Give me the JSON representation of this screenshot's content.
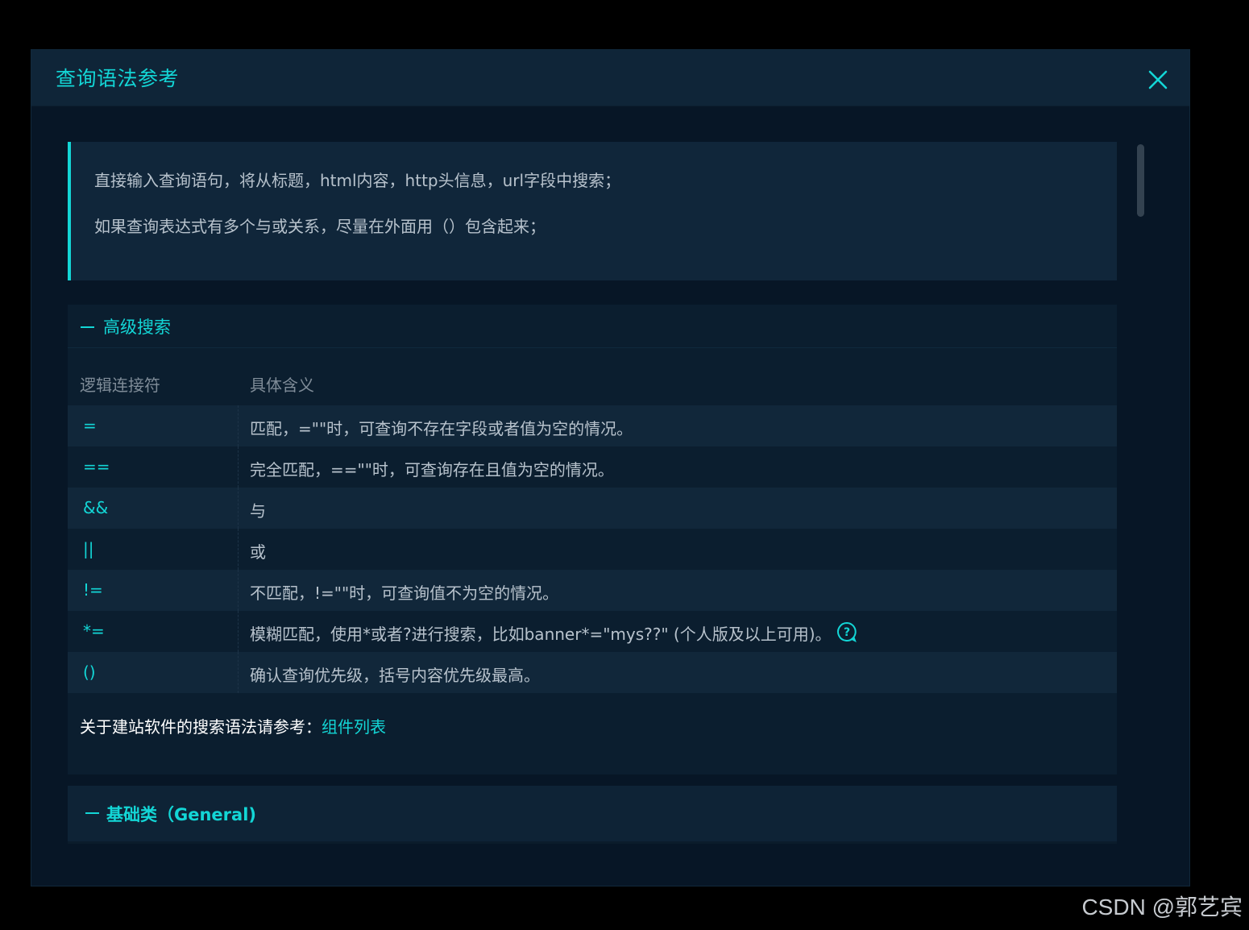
{
  "modal": {
    "title": "查询语法参考"
  },
  "tips": [
    "直接输入查询语句，将从标题，html内容，http头信息，url字段中搜索；",
    "如果查询表达式有多个与或关系，尽量在外面用（）包含起来；"
  ],
  "advanced": {
    "title": "高级搜索",
    "columns": [
      "逻辑连接符",
      "具体含义"
    ],
    "rows": [
      {
        "op": "=",
        "desc": "匹配，=\"\"时，可查询不存在字段或者值为空的情况。"
      },
      {
        "op": "==",
        "desc": "完全匹配，==\"\"时，可查询存在且值为空的情况。"
      },
      {
        "op": "&&",
        "desc": "与"
      },
      {
        "op": "||",
        "desc": "或"
      },
      {
        "op": "!=",
        "desc": "不匹配，!=\"\"时，可查询值不为空的情况。"
      },
      {
        "op": "*=",
        "desc": "模糊匹配，使用*或者?进行搜索，比如banner*=\"mys??\" (个人版及以上可用)。"
      },
      {
        "op": "()",
        "desc": "确认查询优先级，括号内容优先级最高。"
      }
    ],
    "reference_text": "关于建站软件的搜索语法请参考：",
    "reference_link": "组件列表"
  },
  "general": {
    "title": "基础类（General)"
  },
  "watermark": "CSDN @郭艺宾",
  "colors": {
    "accent": "#13d6d6",
    "background": "#000000",
    "modal_bg": "#071626",
    "header_bg": "#0f2538",
    "row_odd": "#11273a",
    "row_even": "#0b1e2f",
    "text": "#b7c2cc"
  },
  "icons": {
    "close": "close-icon",
    "help": "question-circle-icon"
  }
}
